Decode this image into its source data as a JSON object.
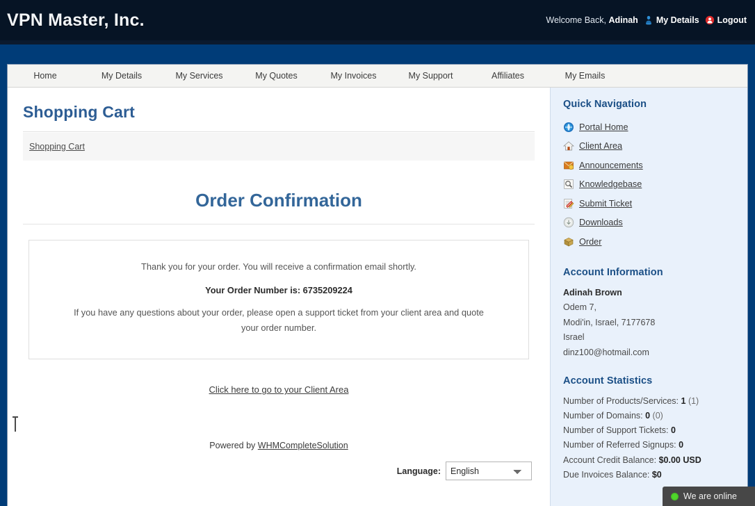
{
  "header": {
    "brand": "VPN Master, Inc.",
    "welcome_prefix": "Welcome Back, ",
    "welcome_name": "Adinah",
    "my_details_label": "My Details",
    "logout_label": "Logout"
  },
  "nav": {
    "tabs": [
      {
        "label": "Home"
      },
      {
        "label": "My Details"
      },
      {
        "label": "My Services"
      },
      {
        "label": "My Quotes"
      },
      {
        "label": "My Invoices"
      },
      {
        "label": "My Support"
      },
      {
        "label": "Affiliates"
      },
      {
        "label": "My Emails"
      }
    ]
  },
  "main": {
    "page_title": "Shopping Cart",
    "breadcrumb": "Shopping Cart",
    "order_title": "Order Confirmation",
    "thanks_line": "Thank you for your order. You will receive a confirmation email shortly.",
    "order_number_line": "Your Order Number is: 6735209224",
    "questions_line": "If you have any questions about your order, please open a support ticket from your client area and quote your order number.",
    "client_area_link": "Click here to go to your Client Area",
    "powered_prefix": "Powered by ",
    "powered_link": "WHMCompleteSolution",
    "language_label": "Language:",
    "language_value": "English",
    "language_options": [
      "English"
    ]
  },
  "sidebar": {
    "quick_nav_title": "Quick Navigation",
    "quick_nav": [
      {
        "label": "Portal Home",
        "icon": "globe-icon"
      },
      {
        "label": "Client Area",
        "icon": "home-icon"
      },
      {
        "label": "Announcements",
        "icon": "announcement-icon"
      },
      {
        "label": "Knowledgebase",
        "icon": "magnifier-icon"
      },
      {
        "label": "Submit Ticket",
        "icon": "ticket-icon"
      },
      {
        "label": "Downloads",
        "icon": "download-icon"
      },
      {
        "label": "Order",
        "icon": "box-icon"
      }
    ],
    "account_info_title": "Account Information",
    "account_info": {
      "name": "Adinah Brown",
      "address1": "Odem 7,",
      "address2": "Modi'in, Israel, 7177678",
      "country": "Israel",
      "email": "dinz100@hotmail.com"
    },
    "account_stats_title": "Account Statistics",
    "account_stats": [
      {
        "label": "Number of Products/Services: ",
        "value": "1",
        "extra": " (1)"
      },
      {
        "label": "Number of Domains: ",
        "value": "0",
        "extra": " (0)"
      },
      {
        "label": "Number of Support Tickets: ",
        "value": "0",
        "extra": ""
      },
      {
        "label": "Number of Referred Signups: ",
        "value": "0",
        "extra": ""
      },
      {
        "label": "Account Credit Balance: ",
        "value": "$0.00 USD",
        "extra": ""
      },
      {
        "label": "Due Invoices Balance: ",
        "value": "$0",
        "extra": ""
      }
    ]
  },
  "chat_widget": {
    "status_text": "We are online",
    "status_color": "#4fd62b"
  }
}
